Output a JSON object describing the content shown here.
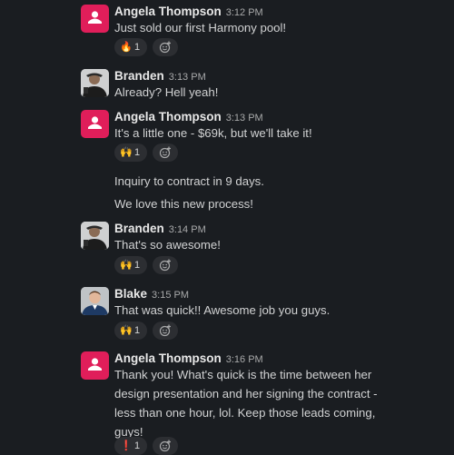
{
  "messages": [
    {
      "author": "Angela Thompson",
      "time": "3:12 PM",
      "lines": [
        "Just sold our first Harmony pool!"
      ],
      "reaction": {
        "emoji": "🔥",
        "count": "1"
      }
    },
    {
      "author": "Branden",
      "time": "3:13 PM",
      "lines": [
        "Already? Hell yeah!"
      ]
    },
    {
      "author": "Angela Thompson",
      "time": "3:13 PM",
      "lines": [
        "It's a little one - $69k, but we'll take it!",
        "Inquiry to contract in 9 days.",
        "We love this new process!"
      ],
      "reaction": {
        "emoji": "🙌",
        "count": "1"
      }
    },
    {
      "author": "Branden",
      "time": "3:14 PM",
      "lines": [
        "That's so awesome!"
      ],
      "reaction": {
        "emoji": "🙌",
        "count": "1"
      }
    },
    {
      "author": "Blake",
      "time": "3:15 PM",
      "lines": [
        "That was quick!! Awesome job you guys."
      ],
      "reaction": {
        "emoji": "🙌",
        "count": "1"
      }
    },
    {
      "author": "Angela Thompson",
      "time": "3:16 PM",
      "lines": [
        "Thank you! What's quick is the time between her design presentation and her signing the contract - less than one hour, lol.  Keep those leads coming, guys!"
      ],
      "reaction": {
        "emoji": "❗",
        "count": "1"
      }
    }
  ],
  "icons": {
    "add_reaction": "add-reaction-icon",
    "angela_avatar": "slack-default-avatar-icon"
  },
  "colors": {
    "background": "#1a1d21",
    "angela_avatar": "#e01e5a"
  }
}
